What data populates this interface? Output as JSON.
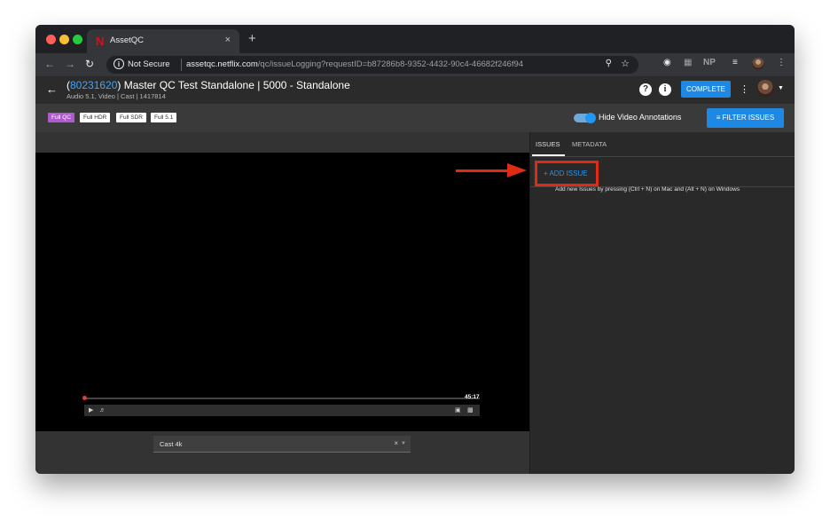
{
  "browser": {
    "tab_title": "AssetQC",
    "tab_favicon": "N",
    "tab_close": "×",
    "new_tab": "+",
    "security_label": "Not Secure",
    "url_host": "assetqc.netflix.com",
    "url_path": "/qc/issueLogging?requestID=b87286b8-9352-4432-90c4-46682f246f94",
    "extension_np": "NP"
  },
  "header": {
    "title_open": "(",
    "title_link": "80231620",
    "title_rest": ") Master QC Test Standalone | 5000 - Standalone",
    "subtitle": "Audio 5.1, Video | Cast | 1417814",
    "help_icon_glyph": "?",
    "info_icon_glyph": "i",
    "complete_label": "COMPLETE"
  },
  "filters": {
    "chips": [
      {
        "label": "Full QC",
        "active": true
      },
      {
        "label": "Full HDR",
        "active": false
      },
      {
        "label": "Full SDR",
        "active": false
      },
      {
        "label": "Full 5.1",
        "active": false
      }
    ],
    "hide_annotations_label": "Hide Video Annotations",
    "hide_annotations_on": true,
    "filter_issues_label": "FILTER ISSUES"
  },
  "player": {
    "duration": "45:17",
    "progress": 0,
    "track_select_value": "Cast 4k",
    "track_select_clear": "×"
  },
  "panel": {
    "tabs": [
      "ISSUES",
      "METADATA"
    ],
    "active_tab": "ISSUES",
    "add_issue_label": "+ ADD ISSUE",
    "hint": "Add new Issues by pressing (Ctrl + N) on Mac and (Alt + N) on Windows"
  },
  "colors": {
    "accent_blue": "#1e88e5",
    "link_blue": "#4aa3f0",
    "chip_active": "#b15ad0",
    "annotation_red": "#e02b14"
  }
}
